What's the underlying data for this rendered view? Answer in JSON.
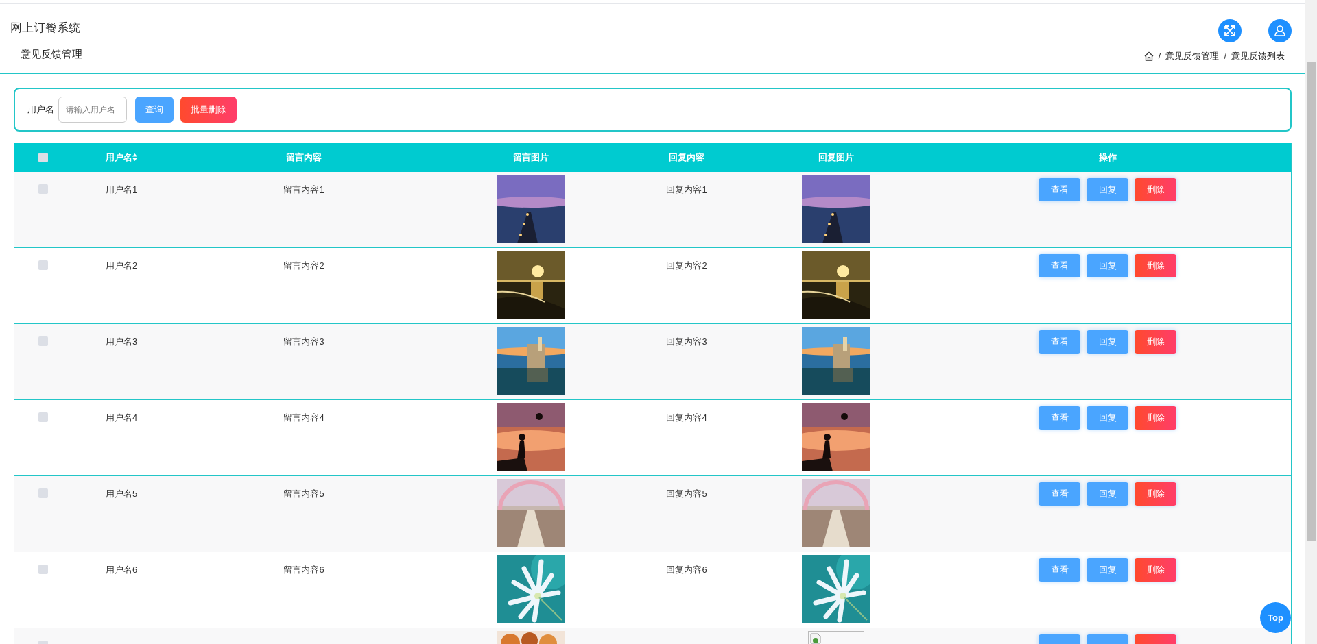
{
  "header": {
    "title": "网上订餐系统",
    "page_title": "意见反馈管理",
    "breadcrumb": [
      "意见反馈管理",
      "意见反馈列表"
    ],
    "breadcrumb_separator": "/"
  },
  "search": {
    "label": "用户名",
    "placeholder": "请输入用户名",
    "buttons": [
      {
        "label": "查询",
        "kind": "primary"
      },
      {
        "label": "批量删除",
        "kind": "danger"
      }
    ]
  },
  "table": {
    "header_checkbox": {
      "checked": false
    },
    "columns": [
      "用户名",
      "留言内容",
      "留言图片",
      "回复内容",
      "回复图片",
      "操作"
    ],
    "rows": [
      {
        "checked": false,
        "user": "用户名1",
        "message": "留言内容1",
        "reply": "回复内容1",
        "actions": [
          {
            "label": "查看",
            "kind": "primary"
          },
          {
            "label": "回复",
            "kind": "primary"
          },
          {
            "label": "删除",
            "kind": "danger"
          }
        ]
      },
      {
        "checked": false,
        "user": "用户名2",
        "message": "留言内容2",
        "reply": "回复内容2",
        "actions": [
          {
            "label": "查看",
            "kind": "primary"
          },
          {
            "label": "回复",
            "kind": "primary"
          },
          {
            "label": "删除",
            "kind": "danger"
          }
        ]
      },
      {
        "checked": false,
        "user": "用户名3",
        "message": "留言内容3",
        "reply": "回复内容3",
        "actions": [
          {
            "label": "查看",
            "kind": "primary"
          },
          {
            "label": "回复",
            "kind": "primary"
          },
          {
            "label": "删除",
            "kind": "danger"
          }
        ]
      },
      {
        "checked": false,
        "user": "用户名4",
        "message": "留言内容4",
        "reply": "回复内容4",
        "actions": [
          {
            "label": "查看",
            "kind": "primary"
          },
          {
            "label": "回复",
            "kind": "primary"
          },
          {
            "label": "删除",
            "kind": "danger"
          }
        ]
      },
      {
        "checked": false,
        "user": "用户名5",
        "message": "留言内容5",
        "reply": "回复内容5",
        "actions": [
          {
            "label": "查看",
            "kind": "primary"
          },
          {
            "label": "回复",
            "kind": "primary"
          },
          {
            "label": "删除",
            "kind": "danger"
          }
        ]
      },
      {
        "checked": false,
        "user": "用户名6",
        "message": "留言内容6",
        "reply": "回复内容6",
        "actions": [
          {
            "label": "查看",
            "kind": "primary"
          },
          {
            "label": "回复",
            "kind": "primary"
          },
          {
            "label": "删除",
            "kind": "danger"
          }
        ]
      },
      {
        "checked": false,
        "reply_image": {
          "kind": "broken"
        },
        "actions": [
          {
            "kind": "primary"
          },
          {
            "kind": "primary"
          },
          {
            "kind": "danger"
          }
        ]
      }
    ]
  },
  "top_button": {
    "label": "Top"
  }
}
